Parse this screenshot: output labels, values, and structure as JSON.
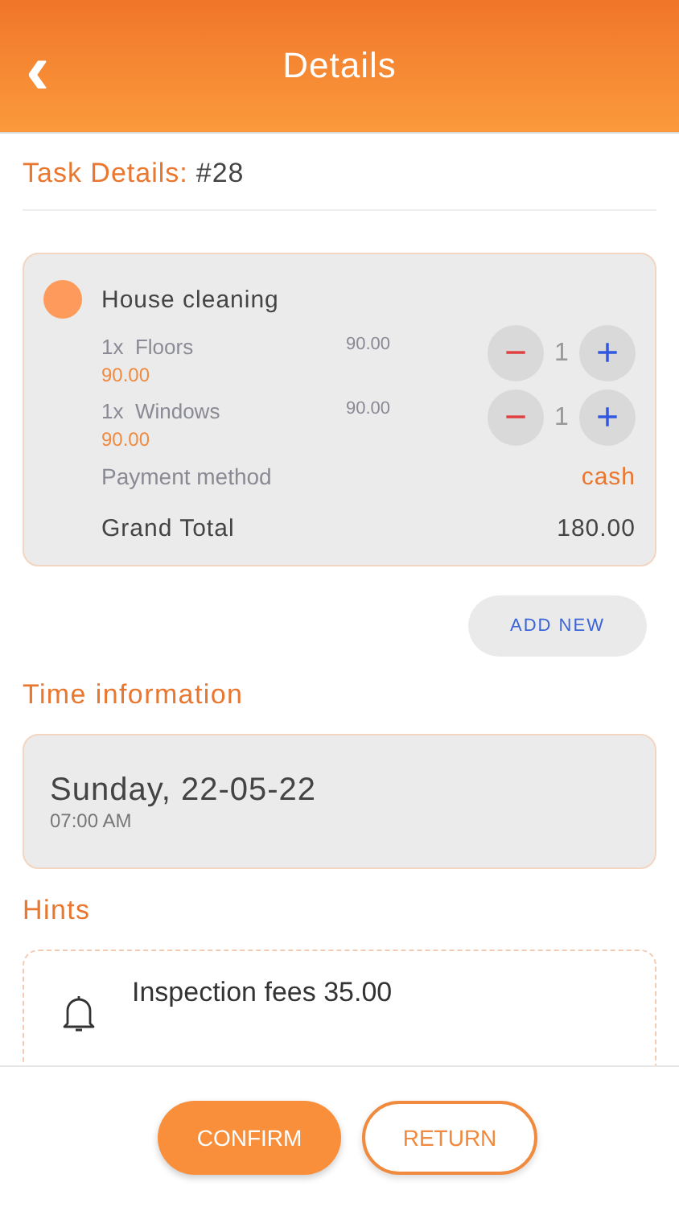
{
  "header": {
    "title": "Details",
    "back_icon": "‹"
  },
  "task": {
    "label": "Task Details:",
    "number": "#28"
  },
  "service": {
    "name": "House cleaning",
    "color": "#fd9a5c",
    "items": [
      {
        "qty": "1x",
        "name": "Floors",
        "total": "90.00",
        "price": "90.00",
        "count": "1",
        "minus": "−",
        "plus": "+"
      },
      {
        "qty": "1x",
        "name": "Windows",
        "total": "90.00",
        "price": "90.00",
        "count": "1",
        "minus": "−",
        "plus": "+"
      }
    ],
    "payment_label": "Payment method",
    "payment_value": "cash",
    "total_label": "Grand Total",
    "total_value": "180.00"
  },
  "add_button": "ADD NEW",
  "time": {
    "heading": "Time information",
    "date": "Sunday, 22-05-22",
    "time": "07:00 AM"
  },
  "hints": {
    "heading": "Hints",
    "items": [
      {
        "title": "Inspection fees 35.00"
      }
    ]
  },
  "buttons": [
    {
      "label": "CONFIRM",
      "kind": "primary"
    },
    {
      "label": "RETURN",
      "kind": "outline"
    }
  ]
}
